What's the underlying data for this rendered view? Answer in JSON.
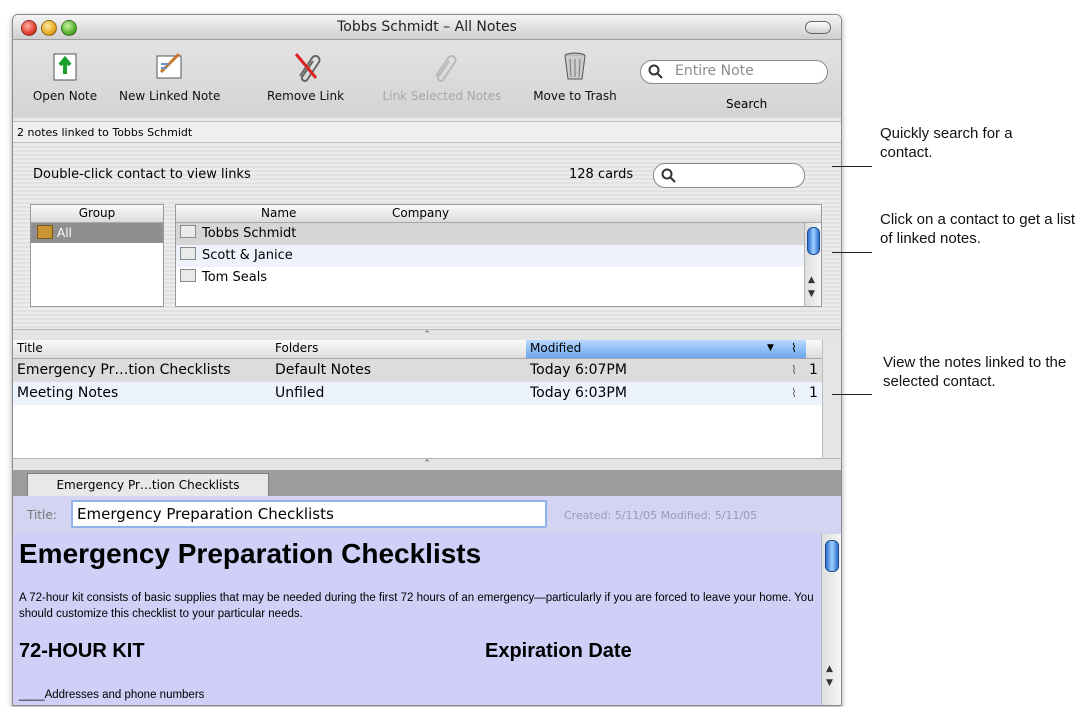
{
  "window": {
    "title": "Tobbs Schmidt – All Notes"
  },
  "toolbar": {
    "open_note": "Open Note",
    "new_linked_note": "New Linked Note",
    "remove_link": "Remove Link",
    "link_selected_notes": "Link Selected Notes",
    "move_to_trash": "Move to Trash",
    "search_placeholder": "Entire Note",
    "search_label": "Search"
  },
  "status": {
    "text": "2 notes linked to Tobbs Schmidt"
  },
  "contacts": {
    "hint": "Double-click contact to view links",
    "count": "128 cards",
    "group_header": "Group",
    "groups": [
      "All"
    ],
    "name_header": "Name",
    "company_header": "Company",
    "names": [
      "Tobbs Schmidt",
      "Scott & Janice",
      "Tom Seals"
    ]
  },
  "notes": {
    "headers": {
      "title": "Title",
      "folders": "Folders",
      "modified": "Modified"
    },
    "rows": [
      {
        "title": "Emergency Pr…tion Checklists",
        "folder": "Default Notes",
        "modified": "Today 6:07PM",
        "count": "1"
      },
      {
        "title": "Meeting Notes",
        "folder": "Unfiled",
        "modified": "Today 6:03PM",
        "count": "1"
      }
    ]
  },
  "tab": {
    "label": "Emergency Pr…tion Checklists"
  },
  "editor": {
    "title_label": "Title:",
    "title_value": "Emergency Preparation Checklists",
    "dates": "Created: 5/11/05  Modified: 5/11/05",
    "heading": "Emergency Preparation Checklists",
    "paragraph": "A 72-hour kit consists of basic supplies that may be needed during  the first 72 hours of an emergency—particularly if you are forced to leave your home. You should customize this checklist to your particular needs.",
    "kit_heading": "72-HOUR KIT",
    "expiration_heading": "Expiration Date",
    "first_item": "____Addresses and phone numbers"
  },
  "callouts": {
    "search": "Quickly search for a contact.",
    "contact": "Click on a contact to get a list of linked notes.",
    "notes": "View the notes linked to the selected contact."
  }
}
